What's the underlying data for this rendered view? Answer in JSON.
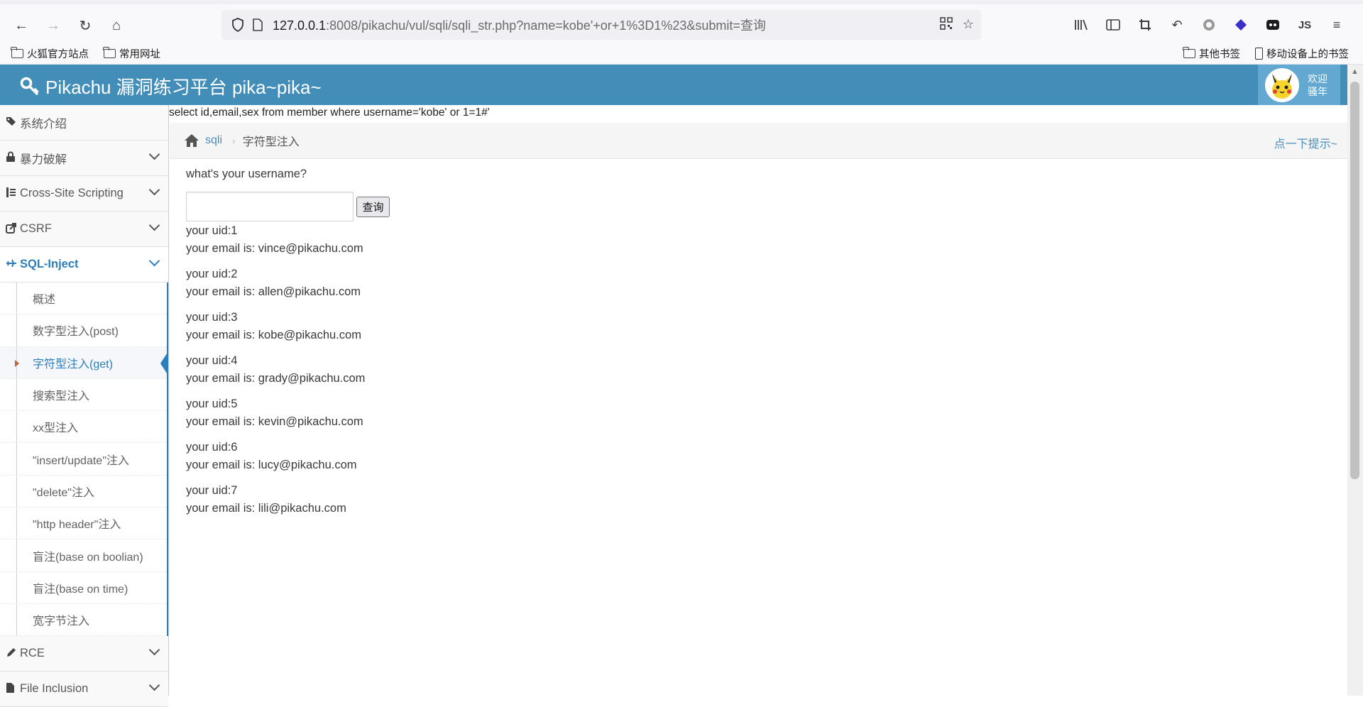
{
  "browser": {
    "url_host": "127.0.0.1",
    "url_rest": ":8008/pikachu/vul/sqli/sqli_str.php?name=kobe'+or+1%3D1%23&submit=查询",
    "bookmarks_left": [
      "火狐官方站点",
      "常用网址"
    ],
    "bookmarks_right": [
      "其他书签",
      "移动设备上的书签"
    ]
  },
  "header": {
    "title": "Pikachu 漏洞练习平台 pika~pika~",
    "user_line1": "欢迎",
    "user_line2": "骚年"
  },
  "sidebar": {
    "items_top": [
      {
        "label": "系统介绍",
        "icon": "tags-icon"
      },
      {
        "label": "暴力破解",
        "icon": "lock-icon"
      },
      {
        "label": "Cross-Site Scripting",
        "icon": "sitemap-icon"
      },
      {
        "label": "CSRF",
        "icon": "share-icon"
      },
      {
        "label": "SQL-Inject",
        "icon": "plane-icon"
      }
    ],
    "sub_items": [
      "概述",
      "数字型注入(post)",
      "字符型注入(get)",
      "搜索型注入",
      "xx型注入",
      "\"insert/update\"注入",
      "\"delete\"注入",
      "\"http header\"注入",
      "盲注(base on boolian)",
      "盲注(base on time)",
      "宽字节注入"
    ],
    "items_bottom": [
      {
        "label": "RCE",
        "icon": "pencil-icon"
      },
      {
        "label": "File Inclusion",
        "icon": "file-icon"
      }
    ]
  },
  "main": {
    "sql_statement": "select id,email,sex from member where username='kobe' or 1=1#'",
    "breadcrumb_link": "sqli",
    "breadcrumb_current": "字符型注入",
    "hint": "点一下提示~",
    "question": "what's your username?",
    "input_value": "",
    "query_button": "查询",
    "results": [
      {
        "uid": "your uid:1",
        "email": "your email is: vince@pikachu.com"
      },
      {
        "uid": "your uid:2",
        "email": "your email is: allen@pikachu.com"
      },
      {
        "uid": "your uid:3",
        "email": "your email is: kobe@pikachu.com"
      },
      {
        "uid": "your uid:4",
        "email": "your email is: grady@pikachu.com"
      },
      {
        "uid": "your uid:5",
        "email": "your email is: kevin@pikachu.com"
      },
      {
        "uid": "your uid:6",
        "email": "your email is: lucy@pikachu.com"
      },
      {
        "uid": "your uid:7",
        "email": "your email is: lili@pikachu.com"
      }
    ]
  }
}
